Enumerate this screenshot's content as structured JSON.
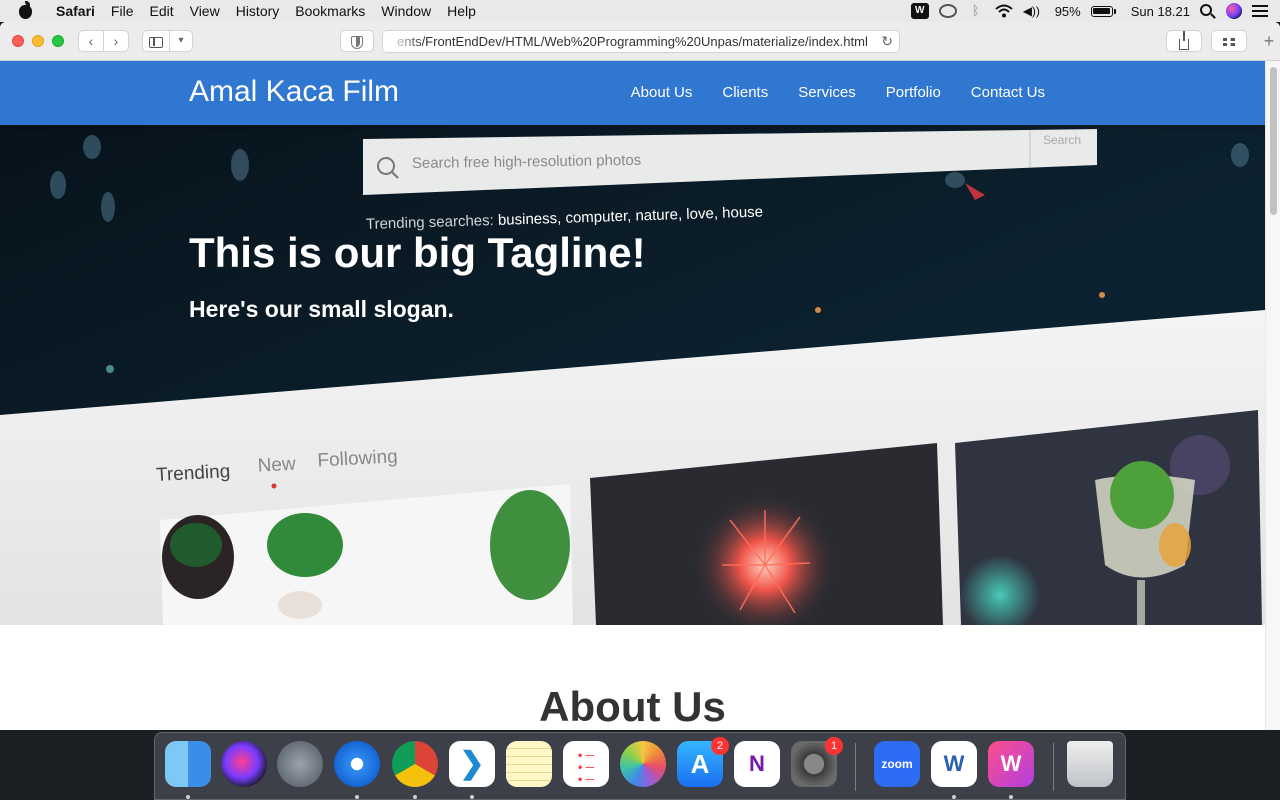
{
  "menubar": {
    "app_name": "Safari",
    "items": [
      "File",
      "Edit",
      "View",
      "History",
      "Bookmarks",
      "Window",
      "Help"
    ],
    "battery_percent": "95%",
    "battery_level": 0.95,
    "clock": "Sun 18.21"
  },
  "browser": {
    "url": "ents/FrontEndDev/HTML/Web%20Programming%20Unpas/materialize/index.html",
    "reload_glyph": "↻",
    "back_glyph": "‹",
    "forward_glyph": "›",
    "new_tab_glyph": "+"
  },
  "site": {
    "brand": "Amal Kaca Film",
    "nav": [
      "About Us",
      "Clients",
      "Services",
      "Portfolio",
      "Contact Us"
    ],
    "nav_color": "#2f77d0",
    "hero": {
      "tagline": "This is our big Tagline!",
      "slogan": "Here's our small slogan.",
      "photo": {
        "search_placeholder": "Search free high-resolution photos",
        "search_button": "Search",
        "trending_prefix": "Trending searches:",
        "trending_terms": "business, computer, nature, love, house",
        "tabs": [
          "Trending",
          "New",
          "Following"
        ]
      }
    },
    "about_title": "About Us"
  },
  "dock": {
    "apps": [
      {
        "name": "Finder",
        "icon": "finder-icon",
        "running": true
      },
      {
        "name": "Siri",
        "icon": "siri-icon",
        "running": false
      },
      {
        "name": "Launchpad",
        "icon": "launchpad-icon",
        "running": false
      },
      {
        "name": "Safari",
        "icon": "safari-icon",
        "running": true
      },
      {
        "name": "Chrome",
        "icon": "chrome-icon",
        "running": true
      },
      {
        "name": "Visual Studio Code",
        "icon": "vscode-icon",
        "running": true
      },
      {
        "name": "Notes",
        "icon": "notes-icon",
        "running": false
      },
      {
        "name": "Reminders",
        "icon": "reminders-icon",
        "running": false
      },
      {
        "name": "Photos",
        "icon": "photos-icon",
        "running": false
      },
      {
        "name": "App Store",
        "icon": "appstore-icon",
        "running": false,
        "badge": "2"
      },
      {
        "name": "OneNote",
        "icon": "onenote-icon",
        "running": false
      },
      {
        "name": "System Preferences",
        "icon": "settings-icon",
        "running": false,
        "badge": "1"
      },
      {
        "name": "Zoom",
        "icon": "zoom-icon",
        "running": false,
        "label": "zoom"
      },
      {
        "name": "Word",
        "icon": "word-icon",
        "running": true
      },
      {
        "name": "WPS Office",
        "icon": "wps-icon",
        "running": true
      },
      {
        "name": "Trash",
        "icon": "trash-icon",
        "running": false
      }
    ]
  }
}
